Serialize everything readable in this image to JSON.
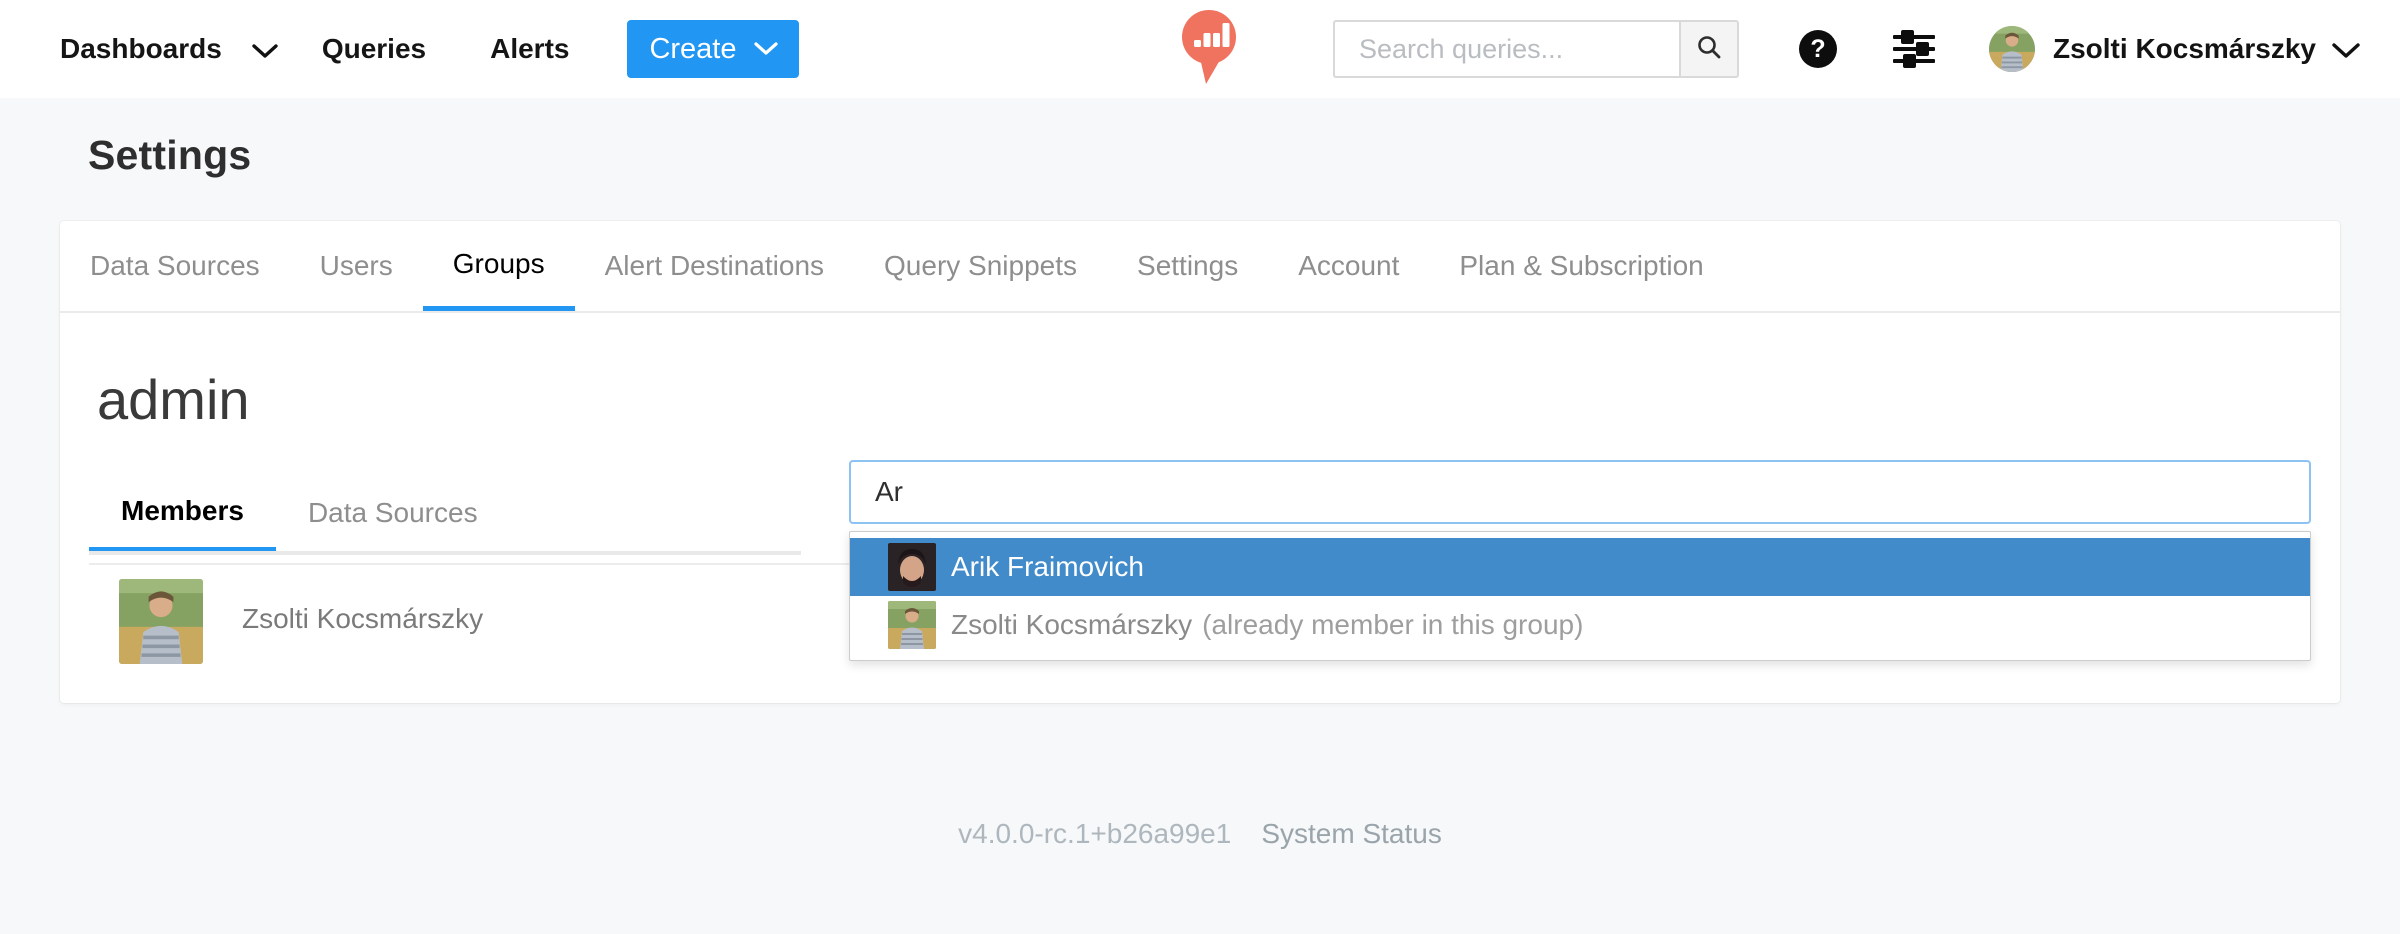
{
  "navbar": {
    "dashboards_label": "Dashboards",
    "queries_label": "Queries",
    "alerts_label": "Alerts",
    "create_label": "Create",
    "search_placeholder": "Search queries...",
    "user_name": "Zsolti Kocsmárszky"
  },
  "page": {
    "title": "Settings"
  },
  "tabs": {
    "active": "Groups",
    "items": [
      {
        "label": "Data Sources"
      },
      {
        "label": "Users"
      },
      {
        "label": "Groups"
      },
      {
        "label": "Alert Destinations"
      },
      {
        "label": "Query Snippets"
      },
      {
        "label": "Settings"
      },
      {
        "label": "Account"
      },
      {
        "label": "Plan & Subscription"
      }
    ]
  },
  "group": {
    "name": "admin",
    "subtabs": {
      "members_label": "Members",
      "data_sources_label": "Data Sources",
      "active": "Members"
    },
    "members": [
      {
        "name": "Zsolti Kocsmárszky"
      }
    ],
    "picker": {
      "value": "Ar",
      "options": [
        {
          "name": "Arik Fraimovich",
          "note": "",
          "highlighted": true
        },
        {
          "name": "Zsolti Kocsmárszky",
          "note": "(already member in this group)",
          "highlighted": false
        }
      ]
    }
  },
  "footer": {
    "version": "v4.0.0-rc.1+b26a99e1",
    "status_label": "System Status"
  },
  "colors": {
    "accent_blue": "#2196f3",
    "option_highlight_blue": "#428bca",
    "brand_coral": "#f0735f"
  }
}
